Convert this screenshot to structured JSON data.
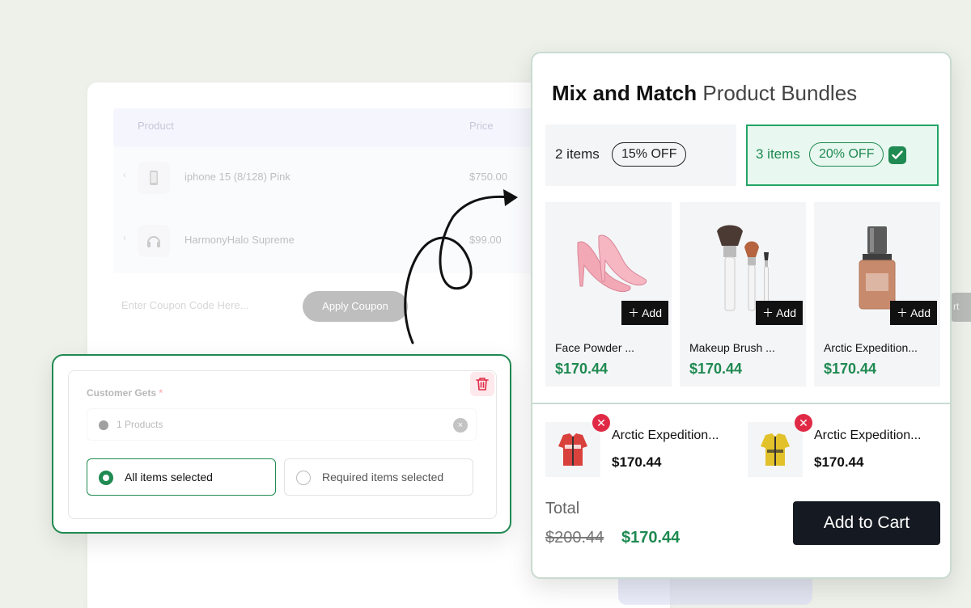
{
  "background_table": {
    "headers": {
      "product": "Product",
      "price": "Price"
    },
    "rows": [
      {
        "name": "iphone 15 (8/128) Pink",
        "price": "$750.00",
        "icon": "phone-icon"
      },
      {
        "name": "HarmonyHalo Supreme",
        "price": "$99.00",
        "icon": "headphones-icon"
      }
    ],
    "coupon_placeholder": "Enter Coupon Code Here...",
    "apply_coupon": "Apply Coupon",
    "side_button_fragment": "rt"
  },
  "customer_gets": {
    "label": "Customer Gets",
    "required_mark": "*",
    "select_value": "1 Products",
    "options": [
      {
        "label": "All items selected",
        "selected": true
      },
      {
        "label": "Required items selected",
        "selected": false
      }
    ]
  },
  "bundle": {
    "title_bold": "Mix and Match",
    "title_light": "Product Bundles",
    "tiers": [
      {
        "label": "2 items",
        "badge": "15% OFF",
        "active": false
      },
      {
        "label": "3 items",
        "badge": "20% OFF",
        "active": true
      }
    ],
    "products": [
      {
        "name": "Face Powder ...",
        "price": "$170.44",
        "add": "Add",
        "image": "pink-heels"
      },
      {
        "name": "Makeup Brush ...",
        "price": "$170.44",
        "add": "Add",
        "image": "makeup-brushes"
      },
      {
        "name": "Arctic Expedition...",
        "price": "$170.44",
        "add": "Add",
        "image": "foundation-bottle"
      }
    ],
    "selected_items": [
      {
        "name": "Arctic Expedition...",
        "price": "$170.44",
        "image": "red-jacket"
      },
      {
        "name": "Arctic Expedition...",
        "price": "$170.44",
        "image": "yellow-jacket"
      }
    ],
    "total_label": "Total",
    "old_total": "$200.44",
    "new_total": "$170.44",
    "add_to_cart": "Add to Cart"
  },
  "colors": {
    "accent_green": "#1f8a52",
    "remove_red": "#e02a45",
    "dark_button": "#151a22",
    "page_bg": "#eef1ea"
  }
}
